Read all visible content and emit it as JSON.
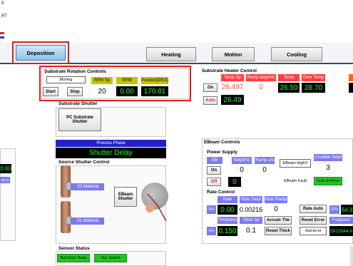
{
  "header": {
    "frag1": "8",
    "frag2": "RT"
  },
  "tabs": [
    {
      "label": "Deposition"
    },
    {
      "label": "Heating"
    },
    {
      "label": "Motion"
    },
    {
      "label": "Cooling"
    }
  ],
  "rotation": {
    "title": "Substrate Rotation Controls",
    "status": "Moving",
    "start": "Start",
    "stop": "Stop",
    "rpm_sp_label": "RPM Sp",
    "rpm_label": "RPM",
    "position_label": "Position[DEG]",
    "rpm_sp": "20",
    "rpm": "0.00",
    "position": "170.81"
  },
  "heater": {
    "title": "Substrate Heater Control",
    "temp_sp_label": "Temp Sp",
    "ramp_label": "Ramp deg/min",
    "temp_label": "Temp",
    "over_temp_label": "Over Temp",
    "temp_sp": "26.497",
    "ramp": "0",
    "temp": "26.50",
    "over_temp": "28.70",
    "on": "On",
    "auto": "Auto",
    "auto_value": "26.49"
  },
  "shutter": {
    "title": "Substrate Shutter",
    "button": "PC Substrate Shutter"
  },
  "process": {
    "label": "Process Phase",
    "value": "Shutter Delay"
  },
  "source_shutter": {
    "title": "Source Shutter Control",
    "s2": "S2 Material",
    "s1": "S1 Material",
    "ebeam": "EBeam Shutter"
  },
  "sensor": {
    "title": "Sensor Status",
    "not_over_temp": "Not Over Temp",
    "vac_switch": "Vac Switch"
  },
  "left_partial": {
    "value": "0.00",
    "label": "ency"
  },
  "ebeam": {
    "title": "EBeam Controls",
    "power_supply": "Power Supply",
    "eb": "EB",
    "setpt_label": "Setpt(%)",
    "ramp_label": "Ramp u/s",
    "setpt": "0",
    "ramp": "0",
    "on": "On",
    "off": "Off",
    "off_value": "0",
    "hv": "EBeam HighV",
    "fault": "EBeam Fault",
    "crucible_label": "Crucible Setpt",
    "crucible": "3",
    "cruc_pos": "Cruc In Posn",
    "rate_control": "Rate Control",
    "rate_label": "Rate",
    "rate_setpt_label": "Rate Setpt",
    "rate_ramp_label": "Rate Ramp",
    "as": "A/s",
    "rate": "0.00",
    "rate_setpt": "0.00216",
    "rate_ramp": "0",
    "rate_auto": "Rate Auto",
    "thickness_label": "Thickness",
    "thick_sp_label": "Thick Sp",
    "accum": "Accum Thk",
    "reset_error": "Reset Error",
    "ka": "kA",
    "thickness": "0.150",
    "thick_sp": "0.1",
    "reset_thick": "Reset Thick",
    "xtal_error": "Xtal Error",
    "pct_label": "G%",
    "pct_value": "64.3",
    "freq_label": "Frequenc",
    "freq_value": "5821944.9"
  },
  "colors": {
    "accent": "#2a4a8c",
    "highlight": "#d92020",
    "value_green": "#22ff22",
    "header_yellow": "#c4c400"
  }
}
